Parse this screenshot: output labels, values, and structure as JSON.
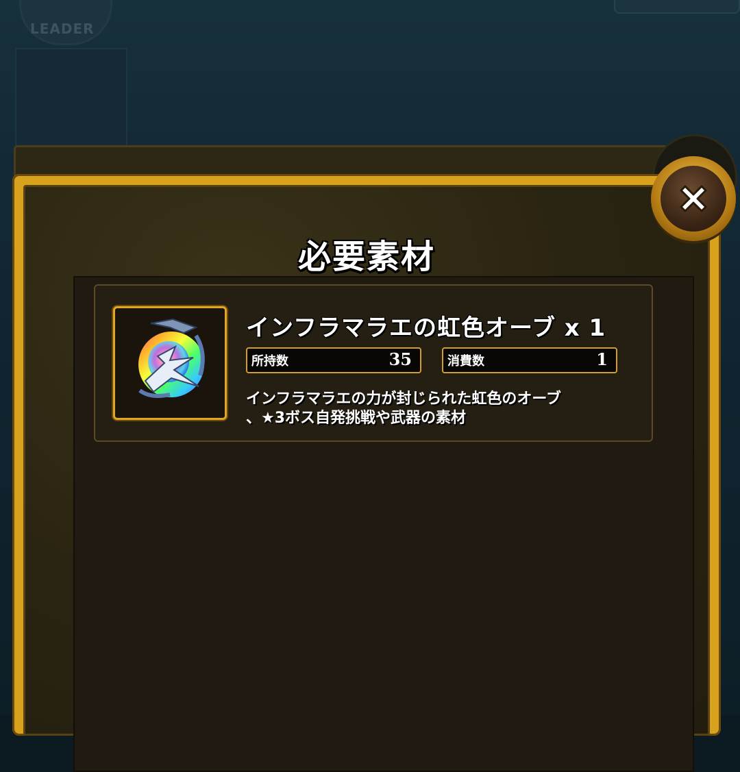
{
  "background": {
    "leader_badge_label": "LEADER"
  },
  "modal": {
    "title": "必要素材",
    "item": {
      "name": "インフラマラエの虹色オーブ x 1",
      "owned_label": "所持数",
      "owned_value": "35",
      "consumed_label": "消費数",
      "consumed_value": "1",
      "description_line1": "インフラマラエの力が封じられた虹色のオーブ",
      "description_line2": "、★3ボス自発挑戦や武器の素材",
      "icon": "rainbow-orb-icon"
    },
    "close_icon": "close-icon"
  },
  "colors": {
    "frame_gold": "#d8a21e",
    "panel_dark": "#2a2412",
    "text_white": "#ffffff"
  }
}
